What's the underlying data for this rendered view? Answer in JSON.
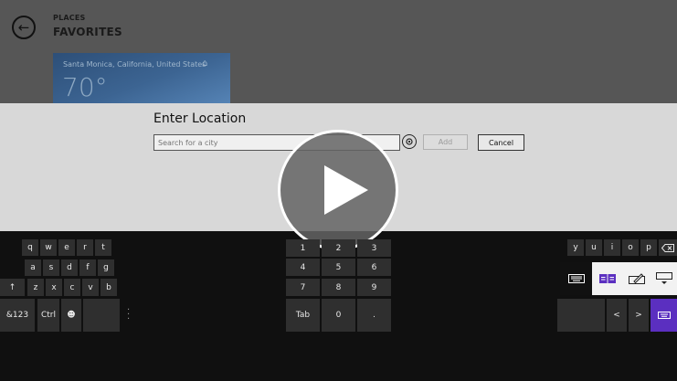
{
  "app": {
    "section": "PLACES",
    "title": "FAVORITES",
    "tile": {
      "city": "Santa Monica, California, United States",
      "temperature": "70°"
    }
  },
  "dialog": {
    "title": "Enter Location",
    "search_placeholder": "Search for a city",
    "search_value": "",
    "add_label": "Add",
    "cancel_label": "Cancel"
  },
  "keyboard": {
    "left": {
      "row1": [
        "q",
        "w",
        "e",
        "r",
        "t"
      ],
      "row2": [
        "a",
        "s",
        "d",
        "f",
        "g"
      ],
      "row3": [
        "↑",
        "z",
        "x",
        "c",
        "v",
        "b"
      ],
      "row4": [
        "&123",
        "Ctrl",
        "☻"
      ]
    },
    "numpad": {
      "row1": [
        "1",
        "2",
        "3"
      ],
      "row2": [
        "4",
        "5",
        "6"
      ],
      "row3": [
        "7",
        "8",
        "9"
      ],
      "row4": [
        "Tab",
        "0",
        "."
      ]
    },
    "right": {
      "row1": [
        "y",
        "u",
        "i",
        "o",
        "p"
      ],
      "arrows": [
        "<",
        ">"
      ]
    }
  },
  "colors": {
    "accent": "#5b2fc0",
    "keyboard_bg": "#101010",
    "key_bg": "#2f2f2f",
    "dialog_bg": "#d8d8d8"
  }
}
